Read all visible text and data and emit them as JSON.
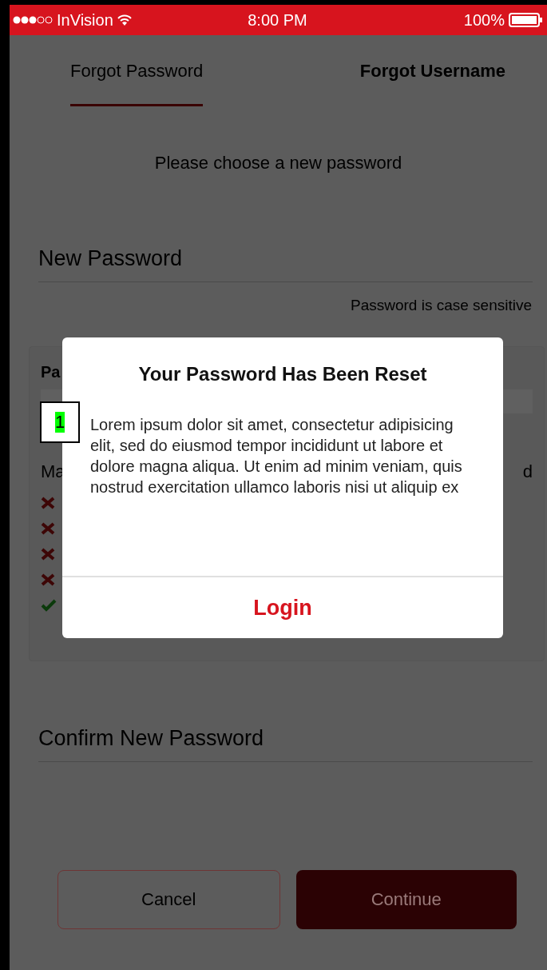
{
  "status_bar": {
    "carrier": "InVision",
    "time": "8:00 PM",
    "battery": "100%"
  },
  "tabs": [
    {
      "label": "Forgot Password",
      "selected": true
    },
    {
      "label": "Forgot Username",
      "selected": false
    }
  ],
  "instruction": "Please choose a new password",
  "new_password": {
    "placeholder": "New Password",
    "hint": "Password is case sensitive"
  },
  "rules_panel": {
    "title": "Pa",
    "line_start": "Ma",
    "line_end": "d",
    "rules": [
      {
        "passed": false
      },
      {
        "passed": false
      },
      {
        "passed": false
      },
      {
        "passed": false
      },
      {
        "passed": true
      }
    ]
  },
  "confirm_password": {
    "placeholder": "Confirm New Password"
  },
  "buttons": {
    "cancel": "Cancel",
    "continue": "Continue"
  },
  "dialog": {
    "title": "Your Password Has Been Reset",
    "body": "Lorem ipsum dolor sit amet, consectetur adipisicing elit, sed do eiusmod tempor incididunt ut labore et dolore magna aliqua. Ut enim ad minim veniam, quis nostrud exercitation ullamco laboris nisi ut aliquip ex",
    "action": "Login"
  },
  "annotation": "1"
}
